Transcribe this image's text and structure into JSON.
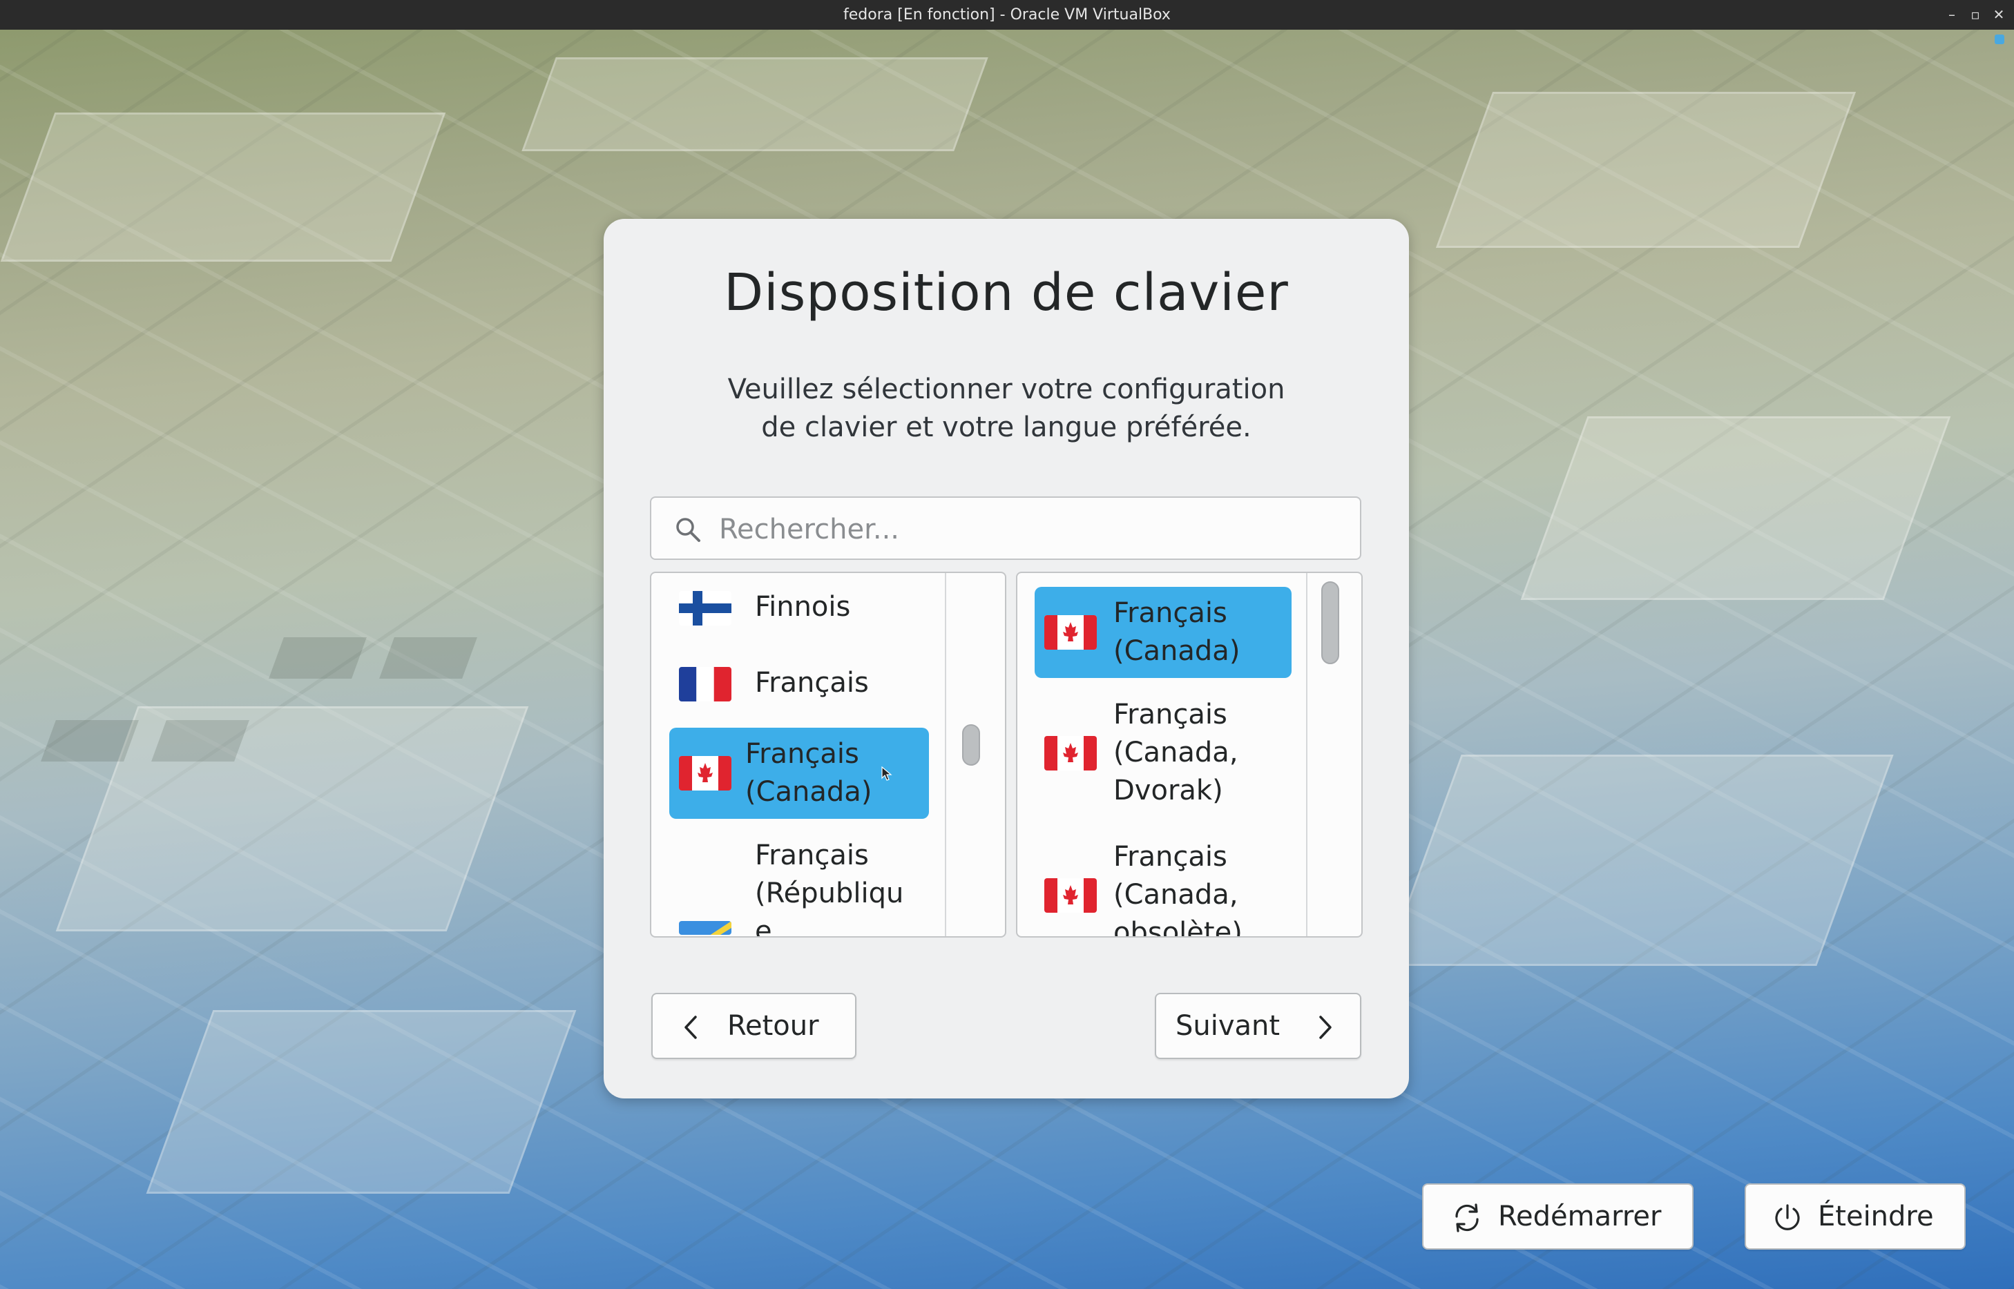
{
  "window": {
    "title": "fedora [En fonction] - Oracle VM VirtualBox",
    "controls": {
      "minimize": "–",
      "maximize": "▫",
      "close": "✕"
    }
  },
  "dialog": {
    "title": "Disposition de clavier",
    "subtitle": "Veuillez sélectionner votre configuration\nde clavier et votre langue préférée.",
    "search": {
      "placeholder": "Rechercher...",
      "value": ""
    }
  },
  "languages": {
    "items": [
      {
        "label": "Finnois",
        "flag": "finland-flag"
      },
      {
        "label": "Français",
        "flag": "france-flag"
      },
      {
        "label": "Français\n(Canada)",
        "flag": "canada-flag",
        "selected": true
      },
      {
        "label": "Français\n(Républiqu\ne",
        "flag": "congo-flag"
      }
    ]
  },
  "layouts": {
    "items": [
      {
        "label": "Français\n(Canada)",
        "flag": "canada-flag",
        "selected": true
      },
      {
        "label": "Français\n(Canada,\nDvorak)",
        "flag": "canada-flag"
      },
      {
        "label": "Français\n(Canada,\nobsolète)",
        "flag": "canada-flag"
      }
    ]
  },
  "buttons": {
    "back": "Retour",
    "next": "Suivant",
    "reboot": "Redémarrer",
    "shutdown": "Éteindre"
  },
  "colors": {
    "selection": "#3daee9",
    "dialog_bg": "#eff0f1",
    "titlebar_bg": "#2b2b2b"
  }
}
